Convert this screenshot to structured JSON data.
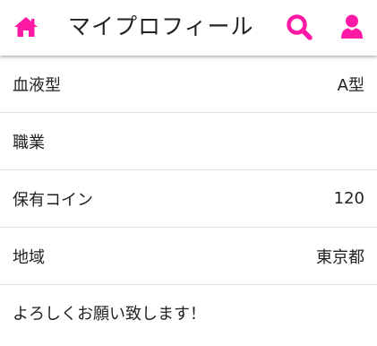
{
  "header": {
    "title": "マイプロフィール",
    "home_icon": "home-icon",
    "search_icon": "search-icon",
    "user_icon": "user-icon",
    "accent_color": "#ff1aa6"
  },
  "profile": {
    "rows": [
      {
        "label": "血液型",
        "value": "A型"
      },
      {
        "label": "職業",
        "value": ""
      },
      {
        "label": "保有コイン",
        "value": "120"
      },
      {
        "label": "地域",
        "value": "東京都"
      }
    ],
    "bio": "よろしくお願い致します！"
  }
}
